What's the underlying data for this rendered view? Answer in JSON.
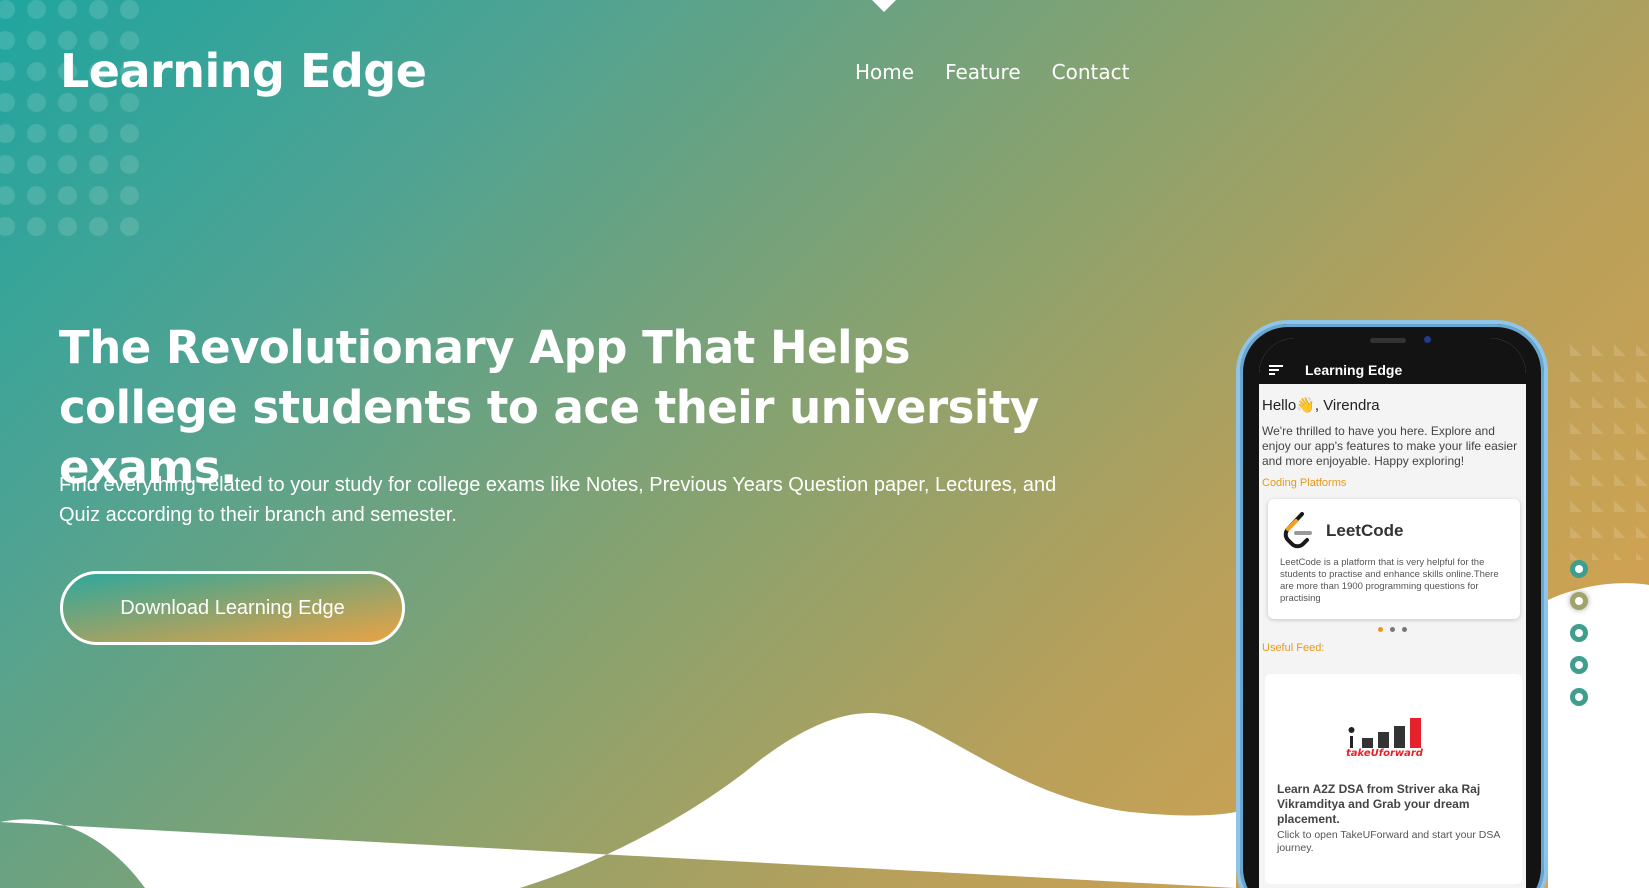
{
  "brand": {
    "title": "Learning Edge"
  },
  "nav": {
    "items": [
      {
        "label": "Home"
      },
      {
        "label": "Feature"
      },
      {
        "label": "Contact"
      }
    ]
  },
  "hero": {
    "headline": "The Revolutionary App That Helps college students to ace their university exams.",
    "subtext": "Find everything related to your study for college exams like Notes, Previous Years Question paper, Lectures, and Quiz according to their branch and semester.",
    "cta_label": "Download Learning Edge"
  },
  "slider": {
    "count": 5,
    "active_index": 1
  },
  "phone_app": {
    "app_bar_title": "Learning Edge",
    "greeting": "Hello👋, Virendra",
    "welcome": "We're thrilled to have you here. Explore and enjoy our app's features to make your life easier and more enjoyable. Happy exploring!",
    "coding_section_label": "Coding Platforms",
    "platform_card": {
      "title": "LeetCode",
      "description": "LeetCode is a platform that is very helpful for the students to practise and enhance skills online.There are more than 1900 programming questions for practising",
      "logo_icon": "leetcode-logo-icon"
    },
    "carousel": {
      "count": 3,
      "active_index": 0
    },
    "feed_section_label": "Useful Feed:",
    "feed_card": {
      "logo_text": "takeUforward",
      "headline": "Learn A2Z DSA from Striver aka Raj Vikramditya and Grab your dream placement.",
      "subtext": "Click to open TakeUForward and start your DSA journey."
    }
  },
  "colors": {
    "gradient_start": "#1fa59f",
    "gradient_end": "#dea44c",
    "accent_orange": "#e79a16",
    "white": "#ffffff"
  }
}
